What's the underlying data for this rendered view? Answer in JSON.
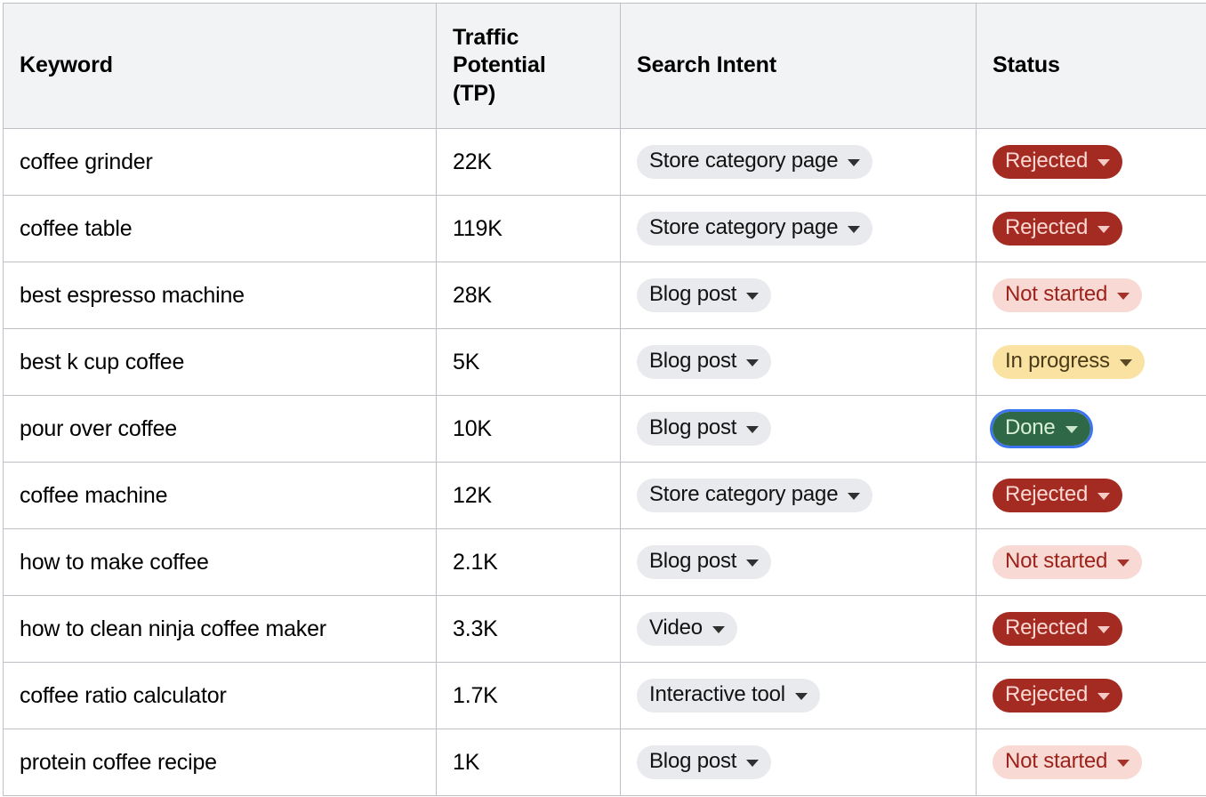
{
  "table": {
    "columns": [
      {
        "key": "keyword",
        "label": "Keyword"
      },
      {
        "key": "tp",
        "label": "Traffic Potential (TP)"
      },
      {
        "key": "intent",
        "label": "Search Intent"
      },
      {
        "key": "status",
        "label": "Status"
      }
    ],
    "rows": [
      {
        "keyword": "coffee grinder",
        "tp": "22K",
        "intent": "Store category page",
        "status": "Rejected",
        "status_kind": "rejected",
        "focused": false
      },
      {
        "keyword": "coffee table",
        "tp": "119K",
        "intent": "Store category page",
        "status": "Rejected",
        "status_kind": "rejected",
        "focused": false
      },
      {
        "keyword": "best espresso machine",
        "tp": "28K",
        "intent": "Blog post",
        "status": "Not started",
        "status_kind": "notstarted",
        "focused": false
      },
      {
        "keyword": "best k cup coffee",
        "tp": "5K",
        "intent": "Blog post",
        "status": "In progress",
        "status_kind": "inprogress",
        "focused": false
      },
      {
        "keyword": "pour over coffee",
        "tp": "10K",
        "intent": "Blog post",
        "status": "Done",
        "status_kind": "done",
        "focused": true
      },
      {
        "keyword": "coffee machine",
        "tp": "12K",
        "intent": "Store category page",
        "status": "Rejected",
        "status_kind": "rejected",
        "focused": false
      },
      {
        "keyword": "how to make coffee",
        "tp": "2.1K",
        "intent": "Blog post",
        "status": "Not started",
        "status_kind": "notstarted",
        "focused": false
      },
      {
        "keyword": "how to clean ninja coffee maker",
        "tp": "3.3K",
        "intent": "Video",
        "status": "Rejected",
        "status_kind": "rejected",
        "focused": false
      },
      {
        "keyword": "coffee ratio calculator",
        "tp": "1.7K",
        "intent": "Interactive tool",
        "status": "Rejected",
        "status_kind": "rejected",
        "focused": false
      },
      {
        "keyword": "protein coffee recipe",
        "tp": "1K",
        "intent": "Blog post",
        "status": "Not started",
        "status_kind": "notstarted",
        "focused": false
      }
    ]
  },
  "icons": {
    "dropdown_caret": "chevron-down-icon"
  },
  "colors": {
    "header_background": "#f1f3f4",
    "grid_border": "#bdc1c6",
    "chip_neutral_background": "#e8eaed",
    "status_rejected_background": "#a32b22",
    "status_rejected_text": "#fbd8d3",
    "status_not_started_background": "#f9d9d4",
    "status_not_started_text": "#9c231b",
    "status_in_progress_background": "#fae3a2",
    "status_in_progress_text": "#4a3b18",
    "status_done_background": "#2f6846",
    "status_done_text": "#d9f0d6",
    "focus_ring": "#3b73f0"
  }
}
